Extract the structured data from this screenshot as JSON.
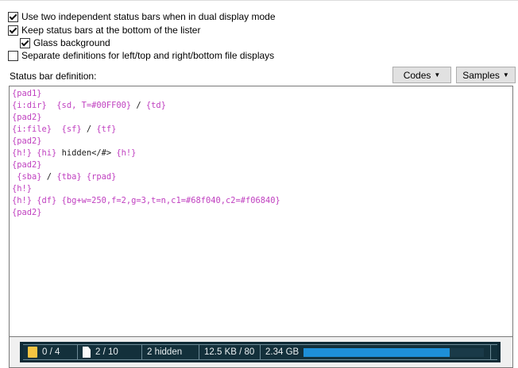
{
  "options": {
    "dual_status_bars": {
      "label": "Use two independent status bars when in dual display mode",
      "checked": true
    },
    "keep_bottom": {
      "label": "Keep status bars at the bottom of the lister",
      "checked": true
    },
    "glass_background": {
      "label": "Glass background",
      "checked": true
    },
    "separate_definitions": {
      "label": "Separate definitions for left/top and right/bottom file displays",
      "checked": false
    }
  },
  "status_bar_definition_label": "Status bar definition:",
  "buttons": {
    "codes": "Codes",
    "samples": "Samples"
  },
  "definition_lines": [
    [
      {
        "t": "{pad1}"
      }
    ],
    [
      {
        "t": "{i:dir}  {sd, T=#00FF00}"
      },
      {
        "t": " / ",
        "d": true
      },
      {
        "t": "{td}"
      }
    ],
    [
      {
        "t": "{pad2}"
      }
    ],
    [
      {
        "t": "{i:file}  {sf}"
      },
      {
        "t": " / ",
        "d": true
      },
      {
        "t": "{tf}"
      }
    ],
    [
      {
        "t": "{pad2}"
      }
    ],
    [
      {
        "t": "{h!} {hi}"
      },
      {
        "t": " hidden</#> ",
        "d": true
      },
      {
        "t": "{h!}"
      }
    ],
    [
      {
        "t": "{pad2}"
      }
    ],
    [
      {
        "t": " {sba}"
      },
      {
        "t": " / ",
        "d": true
      },
      {
        "t": "{tba} {rpad}"
      }
    ],
    [
      {
        "t": "{h!}"
      }
    ],
    [
      {
        "t": "{h!} {df} {bg+w=250,f=2,g=3,t=n,c1=#68f040,c2=#f06840}"
      }
    ],
    [
      {
        "t": "{pad2}"
      }
    ]
  ],
  "status_preview": {
    "dirs": "0 / 4",
    "files": "2 / 10",
    "hidden": "2 hidden",
    "size": "12.5 KB / 80",
    "free": "2.34 GB",
    "free_fill": 0.81
  }
}
